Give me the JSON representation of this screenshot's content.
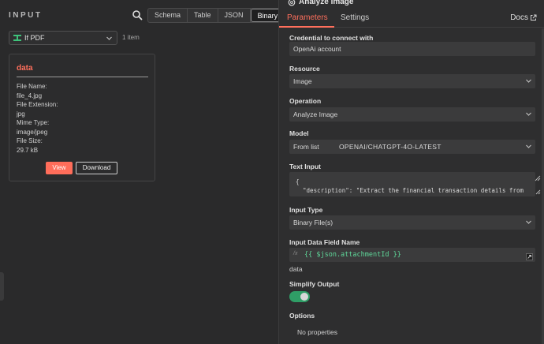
{
  "input_panel": {
    "title": "INPUT",
    "view_tabs": [
      "Schema",
      "Table",
      "JSON",
      "Binary"
    ],
    "active_view": "Binary",
    "branch_select": {
      "value": "If PDF"
    },
    "item_count": "1 item",
    "binary_card": {
      "title": "data",
      "file_name_label": "File Name:",
      "file_name": "file_4.jpg",
      "file_extension_label": "File Extension:",
      "file_extension": "jpg",
      "mime_type_label": "Mime Type:",
      "mime_type": "image/jpeg",
      "file_size_label": "File Size:",
      "file_size": "29.7 kB",
      "view_label": "View",
      "download_label": "Download"
    }
  },
  "node_panel": {
    "title": "Analyze image",
    "tabs": {
      "parameters": "Parameters",
      "settings": "Settings"
    },
    "docs_label": "Docs",
    "fields": {
      "credential": {
        "label": "Credential to connect with",
        "value": "OpenAi account"
      },
      "resource": {
        "label": "Resource",
        "value": "Image"
      },
      "operation": {
        "label": "Operation",
        "value": "Analyze Image"
      },
      "model": {
        "label": "Model",
        "mode": "From list",
        "value": "OPENAI/CHATGPT-4O-LATEST"
      },
      "text_input": {
        "label": "Text Input",
        "line1": "{",
        "line2": "  \"description\": \"Extract the financial transaction details from"
      },
      "input_type": {
        "label": "Input Type",
        "value": "Binary File(s)"
      },
      "input_data_field": {
        "label": "Input Data Field Name",
        "expression": "{{ $json.attachmentId }}",
        "result": "data"
      },
      "simplify_output": {
        "label": "Simplify Output",
        "enabled": true
      },
      "options": {
        "label": "Options",
        "empty_text": "No properties"
      }
    }
  },
  "colors": {
    "accent": "#ff6d5a",
    "toggle_on": "#2f9e66",
    "expression": "#5fd89a",
    "branch_icon": "#3ec27a"
  }
}
